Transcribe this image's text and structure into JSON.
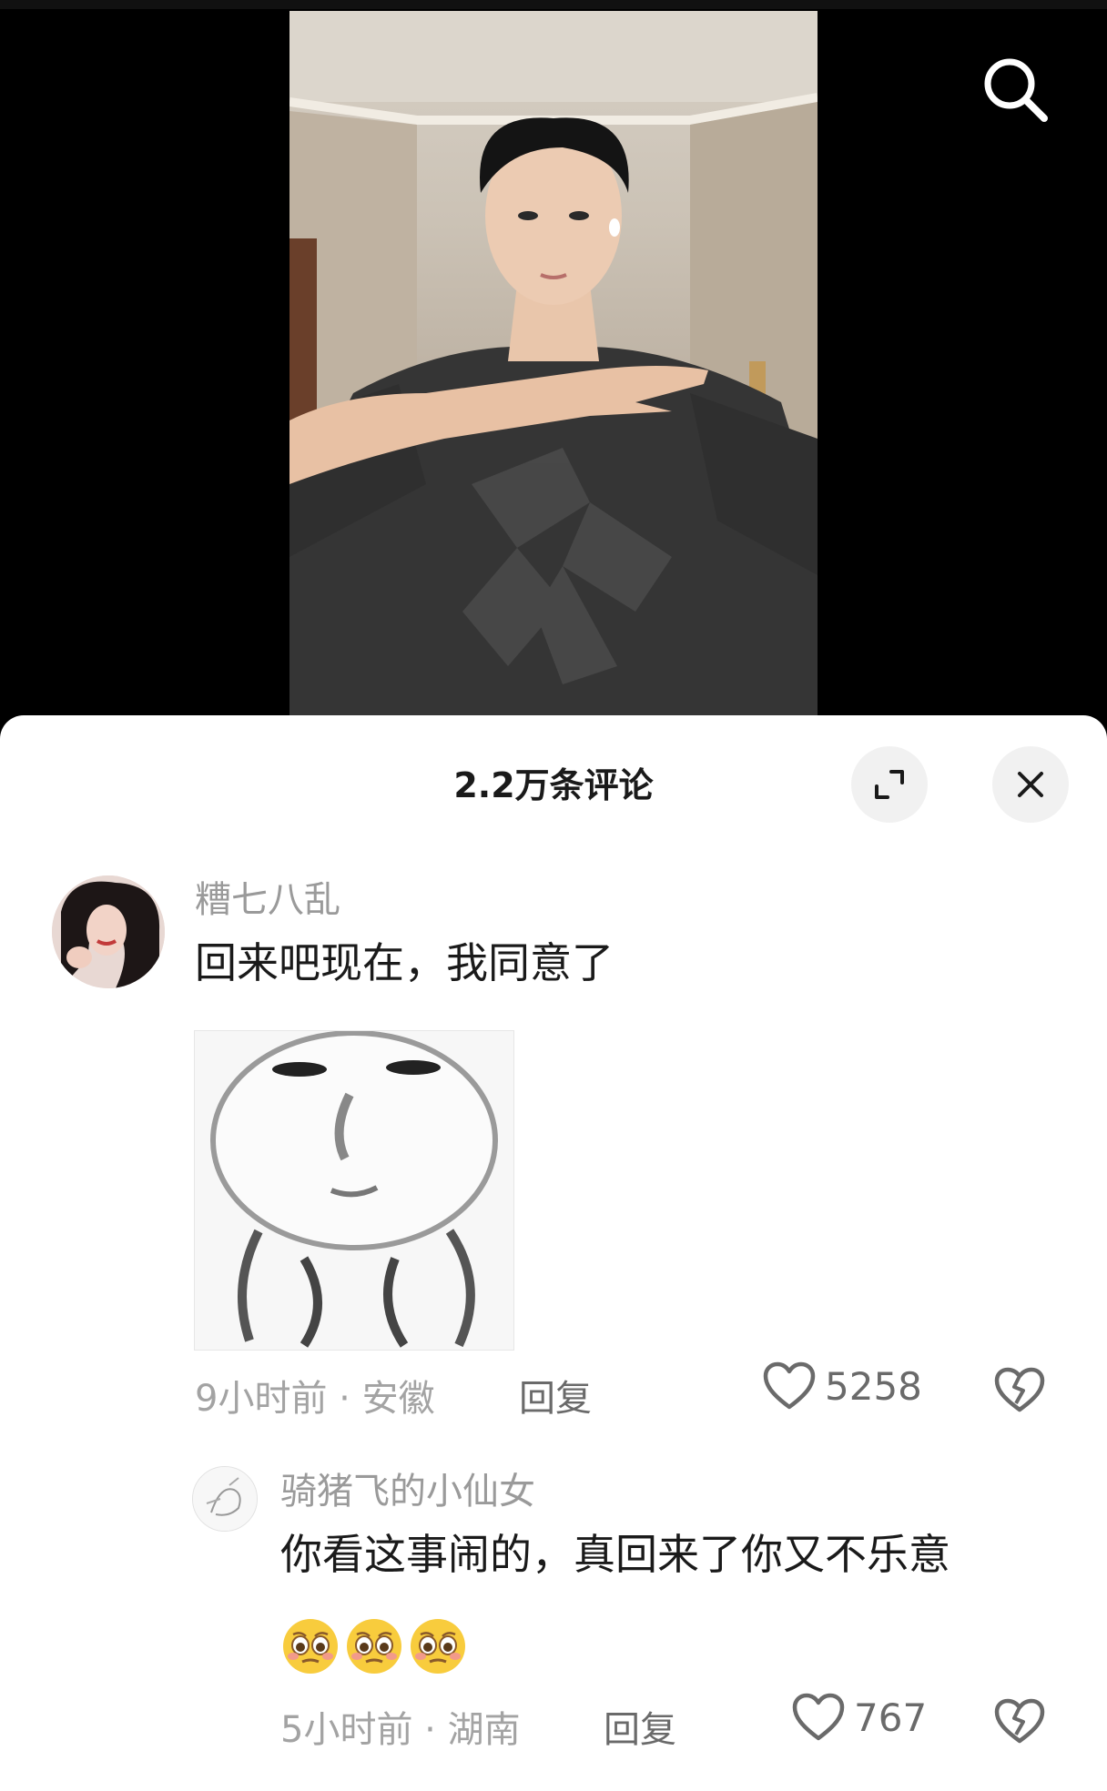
{
  "header": {
    "comments_title": "2.2万条评论"
  },
  "comments": [
    {
      "username": "糟七八乱",
      "text": "回来吧现在，我同意了",
      "time": "9小时前",
      "location": "安徽",
      "reply_label": "回复",
      "likes": "5258",
      "has_sticker": true
    },
    {
      "username": "骑猪飞的小仙女",
      "text": "你看这事闹的，真回来了你又不乐意",
      "emoji_count": 3,
      "time": "5小时前",
      "location": "湖南",
      "reply_label": "回复",
      "likes": "767"
    }
  ],
  "colors": {
    "sheet_bg": "#ffffff",
    "muted": "#9a9a9a",
    "text": "#1a1a1a"
  }
}
